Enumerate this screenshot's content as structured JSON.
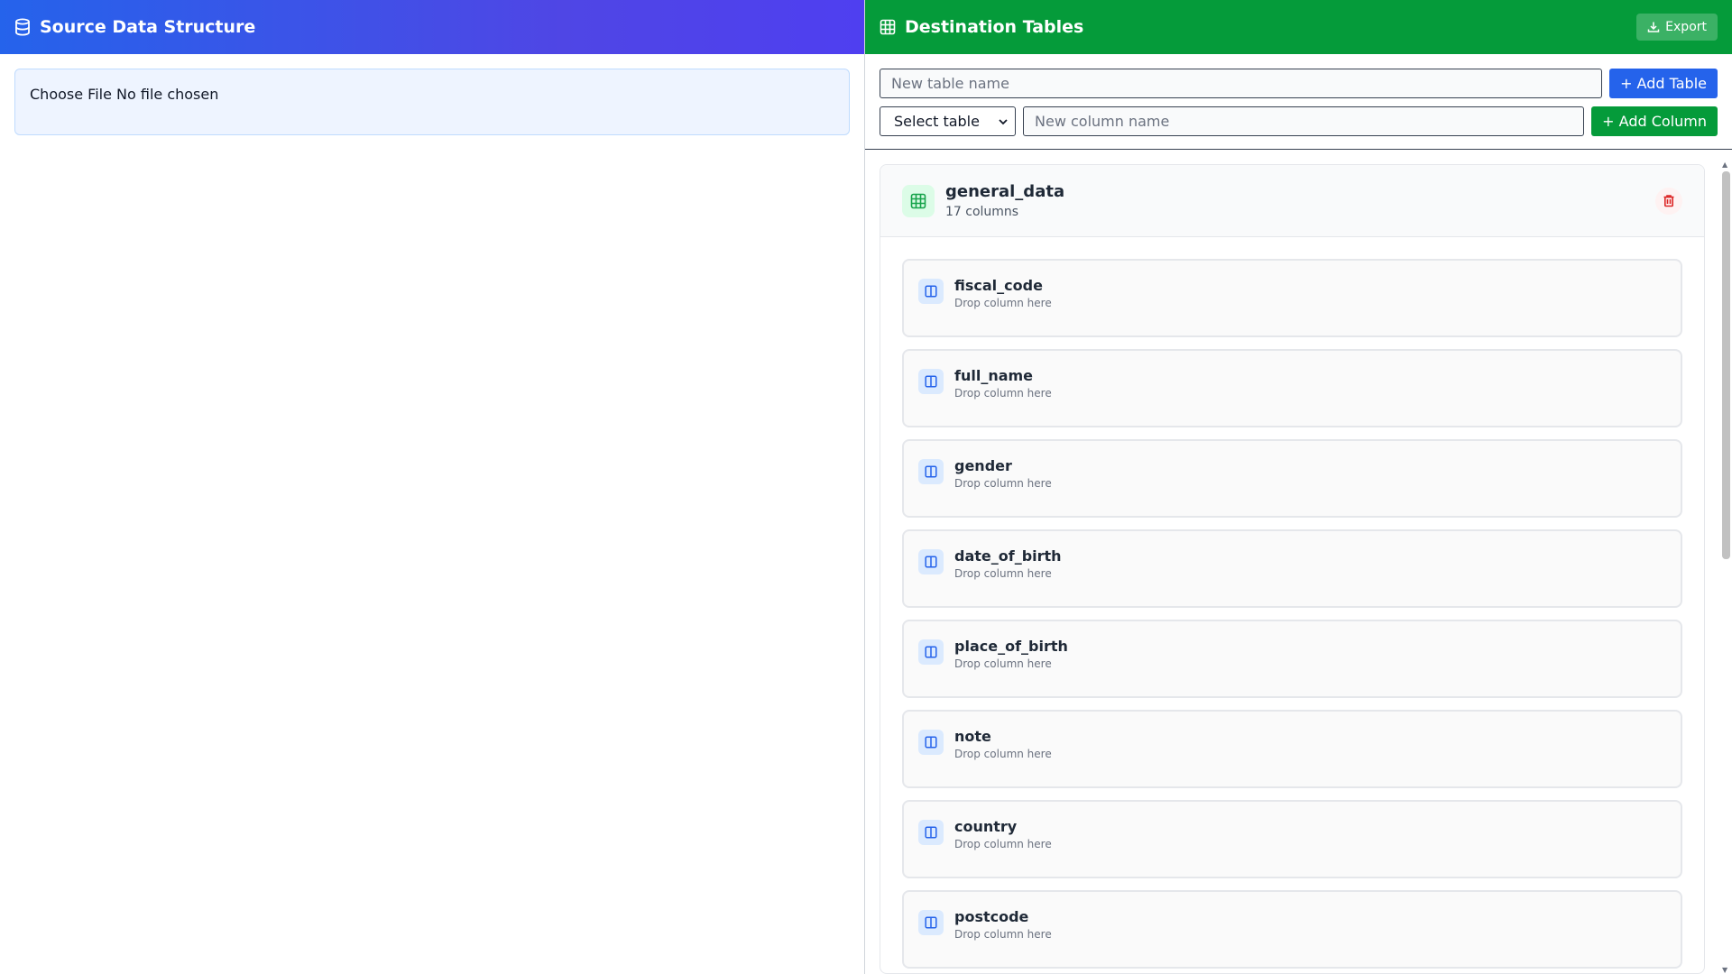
{
  "colors": {
    "source_header_start": "#2563eb",
    "source_header_end": "#4f46e5",
    "destination_header": "#059b3a",
    "add_table_button": "#2563eb",
    "add_column_button": "#059b3a",
    "delete_icon": "#dc2626"
  },
  "source": {
    "title": "Source Data Structure",
    "icon": "database-icon",
    "file_input": {
      "button_label": "Choose File",
      "status": "No file chosen"
    }
  },
  "destination": {
    "title": "Destination Tables",
    "icon": "table-grid-icon",
    "export_label": "Export",
    "new_table_placeholder": "New table name",
    "add_table_label": "+ Add Table",
    "select_table_value": "Select table",
    "new_column_placeholder": "New column name",
    "add_column_label": "+ Add Column",
    "table": {
      "name": "general_data",
      "count_label": "17 columns",
      "columns": [
        {
          "name": "fiscal_code",
          "hint": "Drop column here"
        },
        {
          "name": "full_name",
          "hint": "Drop column here"
        },
        {
          "name": "gender",
          "hint": "Drop column here"
        },
        {
          "name": "date_of_birth",
          "hint": "Drop column here"
        },
        {
          "name": "place_of_birth",
          "hint": "Drop column here"
        },
        {
          "name": "note",
          "hint": "Drop column here"
        },
        {
          "name": "country",
          "hint": "Drop column here"
        },
        {
          "name": "postcode",
          "hint": "Drop column here"
        }
      ]
    }
  }
}
